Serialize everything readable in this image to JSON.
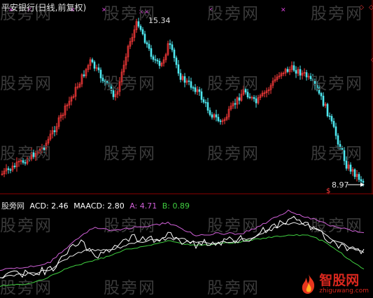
{
  "title": "平安银行(日线,前复权)",
  "watermark": "股旁网",
  "price_high_label": "15.34",
  "price_low_label": "8.97",
  "dollar_marker": "$",
  "indicator": {
    "name": "股旁网",
    "acd": "ACD: 2.46",
    "maacd": "MAACD: 2.80",
    "a": "A: 4.71",
    "b": "B: 0.89"
  },
  "colors": {
    "up": "#ff3b3b",
    "down": "#4fe8f0",
    "acd": "#ffffff",
    "a_line": "#d060d8",
    "b_line": "#40d040",
    "sell_marker": "#d040d0",
    "buy_marker": "#ff3b3b"
  },
  "logo": {
    "text": "智股网",
    "url": "zhiguwang.com"
  },
  "icons": {
    "flame": "flame-icon"
  }
}
